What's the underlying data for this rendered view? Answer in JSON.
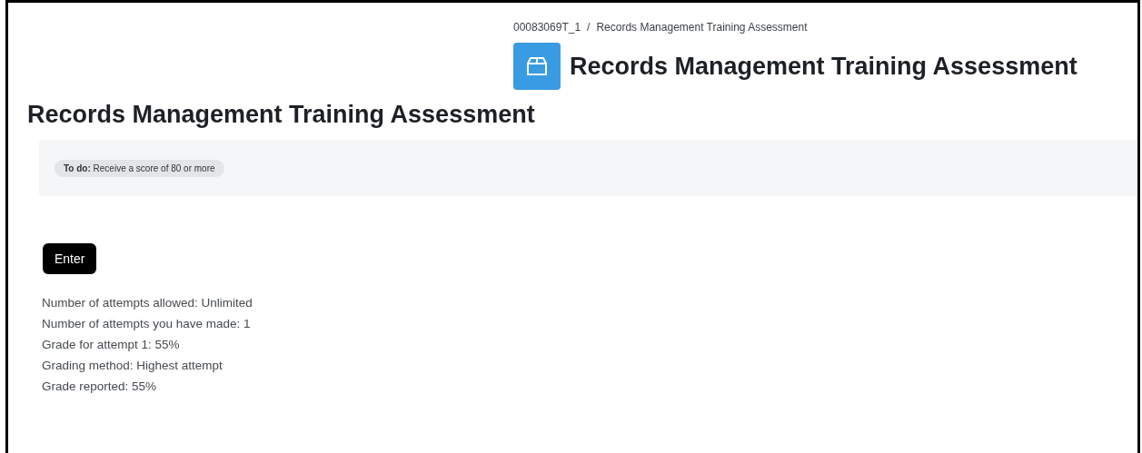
{
  "breadcrumb": {
    "items": [
      "00083069T_1",
      "Records Management Training Assessment"
    ],
    "separator": "/"
  },
  "header": {
    "title": "Records Management Training Assessment"
  },
  "page_title": "Records Management Training Assessment",
  "completion": {
    "label": "To do:",
    "text": "Receive a score of 80 or more"
  },
  "enter_button": "Enter",
  "info_lines": [
    "Number of attempts allowed: Unlimited",
    "Number of attempts you have made: 1",
    "Grade for attempt 1: 55%",
    "Grading method: Highest attempt",
    "Grade reported: 55%"
  ]
}
